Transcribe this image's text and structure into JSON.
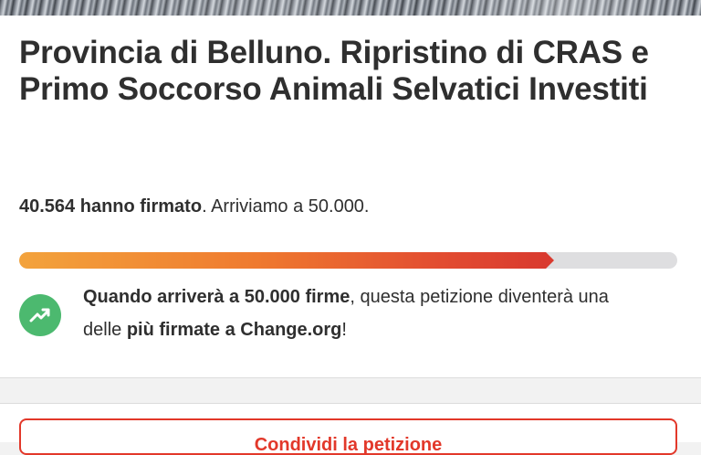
{
  "petition": {
    "title": "Provincia di Belluno. Ripristino di CRAS e Primo Soccorso Animali Selvatici Investiti",
    "signed_count_label": "40.564 hanno firmato",
    "goal_label": ". Arriviamo a 50.000.",
    "progress_fraction": 0.8113,
    "milestone": {
      "bold_part": "Quando arriverà a 50.000 firme",
      "mid_part": ", questa petizione diventerà una delle ",
      "bold_part_2": "più firmate a Change.org",
      "end_part": "!"
    },
    "cta_label": "Condividi la petizione"
  },
  "colors": {
    "accent_red": "#e2382a",
    "progress_start": "#f3a33c",
    "progress_end": "#d93a2f",
    "milestone_green": "#4cb96f",
    "track": "#dedee0"
  },
  "icons": {
    "milestone": "trending-up-icon"
  }
}
